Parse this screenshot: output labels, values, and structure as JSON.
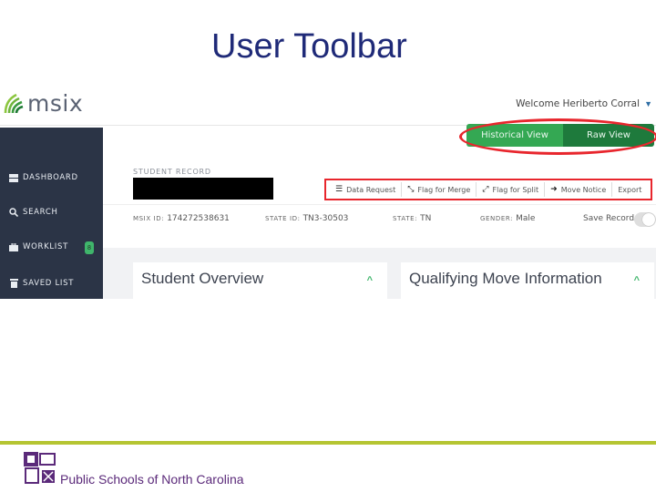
{
  "slide": {
    "title": "User Toolbar",
    "footer_text": "Public Schools of North Carolina"
  },
  "header": {
    "brand": "msix",
    "welcome_text": "Welcome Heriberto Corral"
  },
  "sidebar": {
    "items": [
      {
        "label": "DASHBOARD",
        "icon": "dashboard-icon"
      },
      {
        "label": "SEARCH",
        "icon": "search-icon"
      },
      {
        "label": "WORKLIST",
        "icon": "briefcase-icon",
        "badge": "8"
      },
      {
        "label": "SAVED LIST",
        "icon": "trash-icon"
      }
    ]
  },
  "view_toggle": {
    "historical_label": "Historical View",
    "raw_label": "Raw View"
  },
  "record": {
    "section_label": "STUDENT RECORD",
    "msix_id_label": "MSIX ID:",
    "msix_id": "174272538631",
    "state_id_label": "STATE ID:",
    "state_id": "TN3-30503",
    "state_label": "STATE:",
    "state": "TN",
    "gender_label": "GENDER:",
    "gender": "Male",
    "save_record_label": "Save Record"
  },
  "toolbar": {
    "actions": [
      {
        "label": "Data Request",
        "icon": "list-icon"
      },
      {
        "label": "Flag for Merge",
        "icon": "merge-arrows-icon"
      },
      {
        "label": "Flag for Split",
        "icon": "split-arrows-icon"
      },
      {
        "label": "Move Notice",
        "icon": "arrow-right-icon"
      },
      {
        "label": "Export",
        "icon": "chevron-down-icon"
      }
    ]
  },
  "panels": {
    "student_overview": "Student Overview",
    "qualifying_move": "Qualifying Move Information"
  },
  "colors": {
    "title": "#1f2a78",
    "sidebar": "#2b3446",
    "accent_green": "#34a853",
    "highlight_red": "#e8262d",
    "footer_rule": "#b5c532",
    "footer_text": "#5b2a7a"
  }
}
